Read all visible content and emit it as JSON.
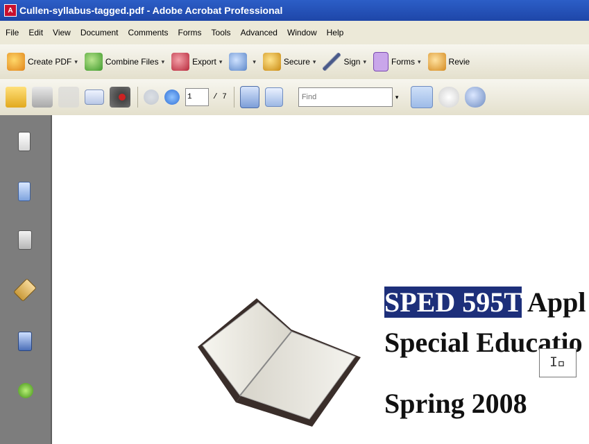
{
  "window": {
    "title": "Cullen-syllabus-tagged.pdf - Adobe Acrobat Professional",
    "app_icon": "acrobat-icon"
  },
  "menubar": {
    "items": [
      "File",
      "Edit",
      "View",
      "Document",
      "Comments",
      "Forms",
      "Tools",
      "Advanced",
      "Window",
      "Help"
    ]
  },
  "toolbar1": {
    "create_pdf": "Create PDF",
    "combine_files": "Combine Files",
    "export": "Export",
    "secure": "Secure",
    "sign": "Sign",
    "forms": "Forms",
    "review": "Revie"
  },
  "toolbar2": {
    "page_current": "1",
    "page_total": "/ 7",
    "find_placeholder": "Find"
  },
  "document": {
    "line1_highlight": "SPED 595T",
    "line1_rest": " Appl",
    "line2": "Special Educ",
    "line2_hidden": "atio",
    "line3": "Spring 2008"
  },
  "colors": {
    "titlebar": "#2c5ec7",
    "highlight": "#1d2f7a",
    "sidebar": "#7d7d7d"
  }
}
